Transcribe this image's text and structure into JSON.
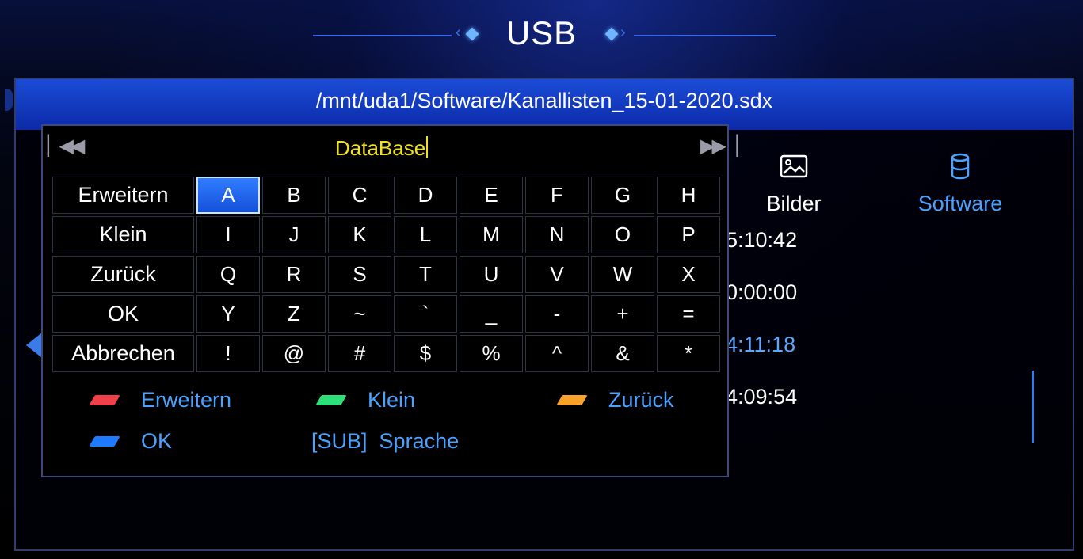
{
  "header": {
    "title": "USB"
  },
  "path": "/mnt/uda1/Software/Kanallisten_15-01-2020.sdx",
  "tabs": [
    {
      "label": "Bilder",
      "icon": "image-icon"
    },
    {
      "label": "Software",
      "icon": "database-icon"
    }
  ],
  "times": [
    "5:10:42",
    "0:00:00",
    "4:11:18",
    "4:09:54"
  ],
  "keyboard": {
    "input_value": "DataBase",
    "rows": [
      [
        "Erweitern",
        "A",
        "B",
        "C",
        "D",
        "E",
        "F",
        "G",
        "H"
      ],
      [
        "Klein",
        "I",
        "J",
        "K",
        "L",
        "M",
        "N",
        "O",
        "P"
      ],
      [
        "Zurück",
        "Q",
        "R",
        "S",
        "T",
        "U",
        "V",
        "W",
        "X"
      ],
      [
        "OK",
        "Y",
        "Z",
        "~",
        "`",
        "_",
        "-",
        "+",
        "="
      ],
      [
        "Abbrechen",
        "!",
        "@",
        "#",
        "$",
        "%",
        "^",
        "&",
        "*"
      ]
    ],
    "selected_key": "A"
  },
  "legend": {
    "red": "Erweitern",
    "green": "Klein",
    "orange": "Zurück",
    "blue": "OK",
    "sub_key": "[SUB]",
    "sub_label": "Sprache"
  },
  "colors": {
    "accent": "#4aa3ff",
    "input_text": "#f1e21e",
    "red": "#f0404a",
    "green": "#2ee07a",
    "orange": "#f7a22a",
    "blue": "#1e7bff"
  }
}
